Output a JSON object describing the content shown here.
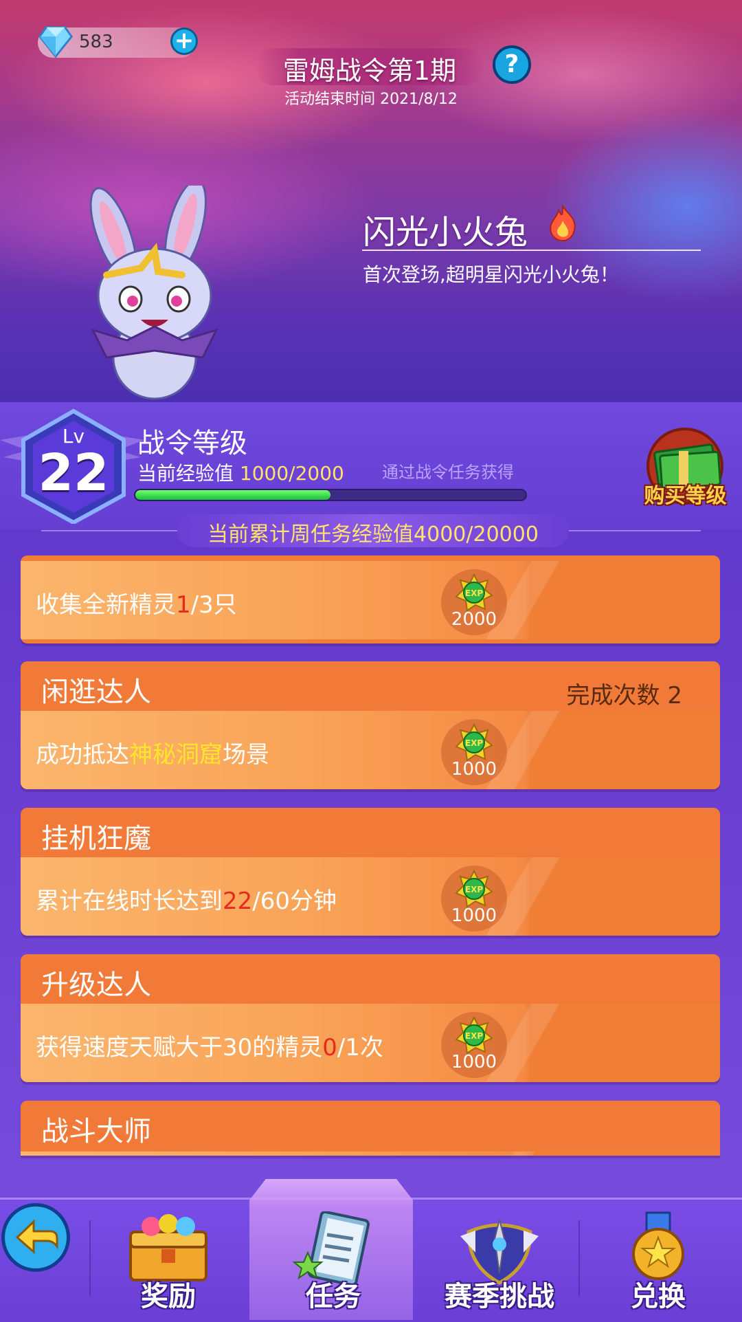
{
  "currency": {
    "value": "583",
    "icon": "diamond-icon"
  },
  "header": {
    "title": "雷姆战令第1期",
    "subtitle": "活动结束时间 2021/8/12"
  },
  "featured_pet": {
    "name": "闪光小火兔",
    "description": "首次登场,超明星闪光小火兔！"
  },
  "level": {
    "lv_label": "Lv",
    "level": "22",
    "title": "战令等级",
    "exp_label": "当前经验值",
    "exp_value": "1000/2000",
    "exp_progress": 0.5,
    "exp_source": "通过战令任务获得",
    "buy_label": "购买等级"
  },
  "weekly": {
    "text": "当前累计周任务经验值4000/20000"
  },
  "tasks": [
    {
      "title": "",
      "count": "",
      "desc_pre": "收集全新精灵",
      "desc_hl": "1",
      "desc_post": "/3只",
      "hl_color": "red",
      "exp": "2000"
    },
    {
      "title": "闲逛达人",
      "count": "完成次数 2",
      "desc_pre": "成功抵达",
      "desc_hl": "神秘洞窟",
      "desc_post": "场景",
      "hl_color": "yellow",
      "exp": "1000"
    },
    {
      "title": "挂机狂魔",
      "count": "",
      "desc_pre": "累计在线时长达到",
      "desc_hl": "22",
      "desc_post": "/60分钟",
      "hl_color": "red",
      "exp": "1000"
    },
    {
      "title": "升级达人",
      "count": "",
      "desc_pre": "获得速度天赋大于30的精灵",
      "desc_hl": "0",
      "desc_post": "/1次",
      "hl_color": "red",
      "exp": "1000"
    },
    {
      "title": "战斗大师",
      "count": ""
    }
  ],
  "exp_badge_text": "EXP",
  "nav": {
    "items": [
      {
        "label": "奖励",
        "icon": "treasure-chest-icon"
      },
      {
        "label": "任务",
        "icon": "clipboard-icon",
        "active": true
      },
      {
        "label": "赛季挑战",
        "icon": "sword-shield-icon"
      },
      {
        "label": "兑换",
        "icon": "medal-icon"
      }
    ]
  },
  "colors": {
    "accent_yellow": "#ffe36a",
    "task_orange": "#f07e35",
    "progress_green": "#19c13a"
  }
}
